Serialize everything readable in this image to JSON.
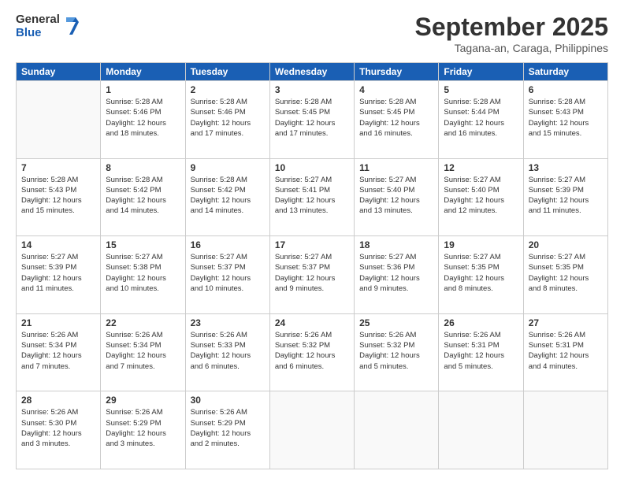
{
  "header": {
    "logo_line1": "General",
    "logo_line2": "Blue",
    "month": "September 2025",
    "location": "Tagana-an, Caraga, Philippines"
  },
  "days_of_week": [
    "Sunday",
    "Monday",
    "Tuesday",
    "Wednesday",
    "Thursday",
    "Friday",
    "Saturday"
  ],
  "weeks": [
    [
      {
        "day": "",
        "info": ""
      },
      {
        "day": "1",
        "info": "Sunrise: 5:28 AM\nSunset: 5:46 PM\nDaylight: 12 hours\nand 18 minutes."
      },
      {
        "day": "2",
        "info": "Sunrise: 5:28 AM\nSunset: 5:46 PM\nDaylight: 12 hours\nand 17 minutes."
      },
      {
        "day": "3",
        "info": "Sunrise: 5:28 AM\nSunset: 5:45 PM\nDaylight: 12 hours\nand 17 minutes."
      },
      {
        "day": "4",
        "info": "Sunrise: 5:28 AM\nSunset: 5:45 PM\nDaylight: 12 hours\nand 16 minutes."
      },
      {
        "day": "5",
        "info": "Sunrise: 5:28 AM\nSunset: 5:44 PM\nDaylight: 12 hours\nand 16 minutes."
      },
      {
        "day": "6",
        "info": "Sunrise: 5:28 AM\nSunset: 5:43 PM\nDaylight: 12 hours\nand 15 minutes."
      }
    ],
    [
      {
        "day": "7",
        "info": "Sunrise: 5:28 AM\nSunset: 5:43 PM\nDaylight: 12 hours\nand 15 minutes."
      },
      {
        "day": "8",
        "info": "Sunrise: 5:28 AM\nSunset: 5:42 PM\nDaylight: 12 hours\nand 14 minutes."
      },
      {
        "day": "9",
        "info": "Sunrise: 5:28 AM\nSunset: 5:42 PM\nDaylight: 12 hours\nand 14 minutes."
      },
      {
        "day": "10",
        "info": "Sunrise: 5:27 AM\nSunset: 5:41 PM\nDaylight: 12 hours\nand 13 minutes."
      },
      {
        "day": "11",
        "info": "Sunrise: 5:27 AM\nSunset: 5:40 PM\nDaylight: 12 hours\nand 13 minutes."
      },
      {
        "day": "12",
        "info": "Sunrise: 5:27 AM\nSunset: 5:40 PM\nDaylight: 12 hours\nand 12 minutes."
      },
      {
        "day": "13",
        "info": "Sunrise: 5:27 AM\nSunset: 5:39 PM\nDaylight: 12 hours\nand 11 minutes."
      }
    ],
    [
      {
        "day": "14",
        "info": "Sunrise: 5:27 AM\nSunset: 5:39 PM\nDaylight: 12 hours\nand 11 minutes."
      },
      {
        "day": "15",
        "info": "Sunrise: 5:27 AM\nSunset: 5:38 PM\nDaylight: 12 hours\nand 10 minutes."
      },
      {
        "day": "16",
        "info": "Sunrise: 5:27 AM\nSunset: 5:37 PM\nDaylight: 12 hours\nand 10 minutes."
      },
      {
        "day": "17",
        "info": "Sunrise: 5:27 AM\nSunset: 5:37 PM\nDaylight: 12 hours\nand 9 minutes."
      },
      {
        "day": "18",
        "info": "Sunrise: 5:27 AM\nSunset: 5:36 PM\nDaylight: 12 hours\nand 9 minutes."
      },
      {
        "day": "19",
        "info": "Sunrise: 5:27 AM\nSunset: 5:35 PM\nDaylight: 12 hours\nand 8 minutes."
      },
      {
        "day": "20",
        "info": "Sunrise: 5:27 AM\nSunset: 5:35 PM\nDaylight: 12 hours\nand 8 minutes."
      }
    ],
    [
      {
        "day": "21",
        "info": "Sunrise: 5:26 AM\nSunset: 5:34 PM\nDaylight: 12 hours\nand 7 minutes."
      },
      {
        "day": "22",
        "info": "Sunrise: 5:26 AM\nSunset: 5:34 PM\nDaylight: 12 hours\nand 7 minutes."
      },
      {
        "day": "23",
        "info": "Sunrise: 5:26 AM\nSunset: 5:33 PM\nDaylight: 12 hours\nand 6 minutes."
      },
      {
        "day": "24",
        "info": "Sunrise: 5:26 AM\nSunset: 5:32 PM\nDaylight: 12 hours\nand 6 minutes."
      },
      {
        "day": "25",
        "info": "Sunrise: 5:26 AM\nSunset: 5:32 PM\nDaylight: 12 hours\nand 5 minutes."
      },
      {
        "day": "26",
        "info": "Sunrise: 5:26 AM\nSunset: 5:31 PM\nDaylight: 12 hours\nand 5 minutes."
      },
      {
        "day": "27",
        "info": "Sunrise: 5:26 AM\nSunset: 5:31 PM\nDaylight: 12 hours\nand 4 minutes."
      }
    ],
    [
      {
        "day": "28",
        "info": "Sunrise: 5:26 AM\nSunset: 5:30 PM\nDaylight: 12 hours\nand 3 minutes."
      },
      {
        "day": "29",
        "info": "Sunrise: 5:26 AM\nSunset: 5:29 PM\nDaylight: 12 hours\nand 3 minutes."
      },
      {
        "day": "30",
        "info": "Sunrise: 5:26 AM\nSunset: 5:29 PM\nDaylight: 12 hours\nand 2 minutes."
      },
      {
        "day": "",
        "info": ""
      },
      {
        "day": "",
        "info": ""
      },
      {
        "day": "",
        "info": ""
      },
      {
        "day": "",
        "info": ""
      }
    ]
  ]
}
